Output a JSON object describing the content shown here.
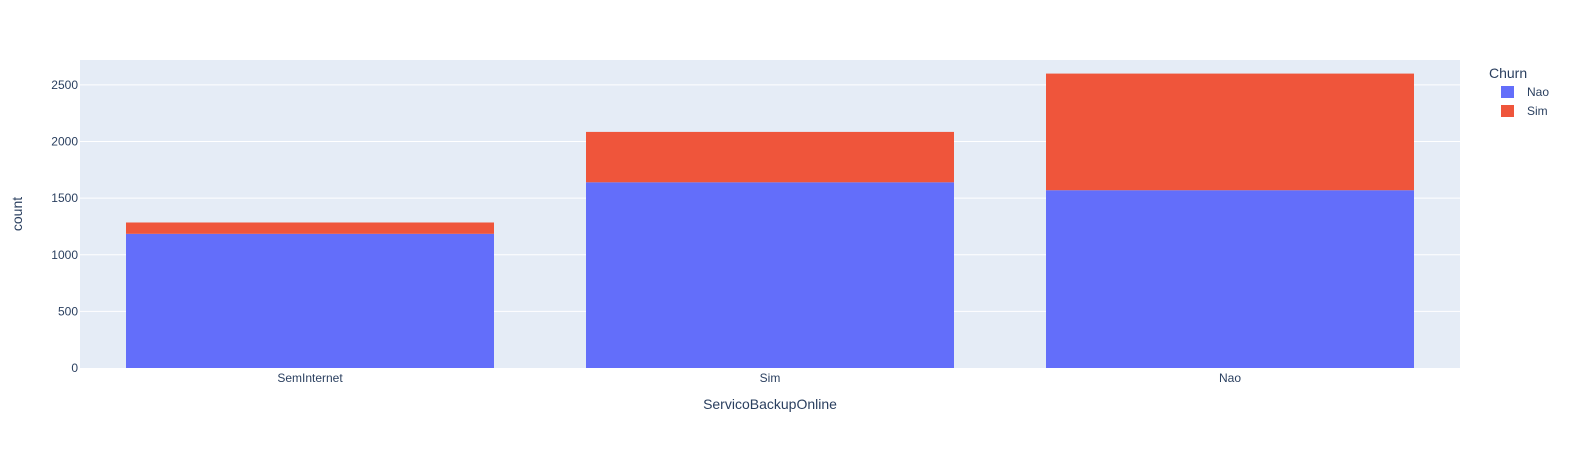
{
  "chart_data": {
    "type": "bar",
    "barmode": "stack",
    "categories": [
      "SemInternet",
      "Sim",
      "Nao"
    ],
    "series": [
      {
        "name": "Nao",
        "values": [
          1185,
          1640,
          1570
        ],
        "color": "#636efa"
      },
      {
        "name": "Sim",
        "values": [
          100,
          445,
          1030
        ],
        "color": "#ef553b"
      }
    ],
    "xlabel": "ServicoBackupOnline",
    "ylabel": "count",
    "ylim": [
      0,
      2720
    ],
    "yticks": [
      0,
      500,
      1000,
      1500,
      2000,
      2500
    ],
    "legend_title": "Churn",
    "legend_position": "top-right",
    "grid": true,
    "plot_background": "#e5ecf6"
  }
}
